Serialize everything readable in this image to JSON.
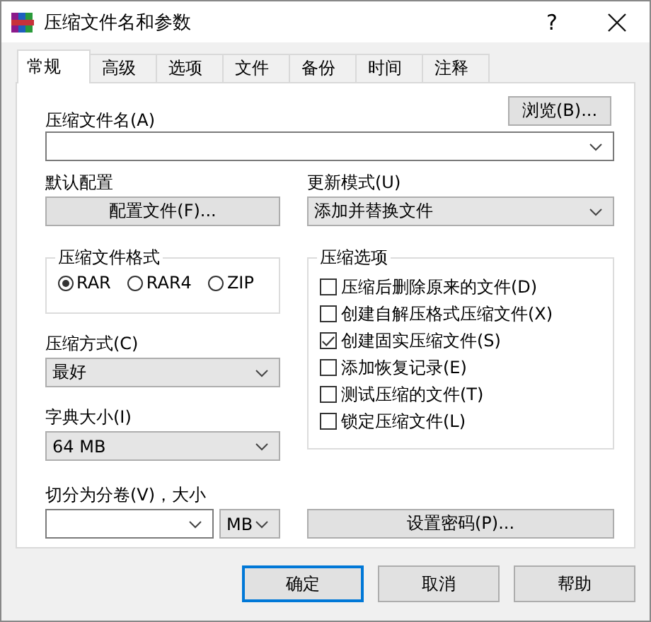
{
  "window": {
    "title": "压缩文件名和参数",
    "help_button": "?"
  },
  "tabs": [
    {
      "label": "常规",
      "selected": true
    },
    {
      "label": "高级",
      "selected": false
    },
    {
      "label": "选项",
      "selected": false
    },
    {
      "label": "文件",
      "selected": false
    },
    {
      "label": "备份",
      "selected": false
    },
    {
      "label": "时间",
      "selected": false
    },
    {
      "label": "注释",
      "selected": false
    }
  ],
  "archive_name": {
    "label": "压缩文件名(A)",
    "browse_button": "浏览(B)..."
  },
  "profile": {
    "label": "默认配置",
    "button": "配置文件(F)..."
  },
  "update_mode": {
    "label": "更新模式(U)",
    "value": "添加并替换文件"
  },
  "archive_format": {
    "label": "压缩文件格式",
    "options": [
      {
        "label": "RAR",
        "selected": true
      },
      {
        "label": "RAR4",
        "selected": false
      },
      {
        "label": "ZIP",
        "selected": false
      }
    ]
  },
  "compression_method": {
    "label": "压缩方式(C)",
    "value": "最好"
  },
  "dictionary_size": {
    "label": "字典大小(I)",
    "value": "64 MB"
  },
  "split_volumes": {
    "label": "切分为分卷(V)，大小",
    "unit": "MB"
  },
  "archiving_options": {
    "label": "压缩选项",
    "items": [
      {
        "label": "压缩后删除原来的文件(D)",
        "checked": false
      },
      {
        "label": "创建自解压格式压缩文件(X)",
        "checked": false
      },
      {
        "label": "创建固实压缩文件(S)",
        "checked": true
      },
      {
        "label": "添加恢复记录(E)",
        "checked": false
      },
      {
        "label": "测试压缩的文件(T)",
        "checked": false
      },
      {
        "label": "锁定压缩文件(L)",
        "checked": false
      }
    ]
  },
  "password_button": "设置密码(P)...",
  "buttons": [
    {
      "label": "确定",
      "default": true
    },
    {
      "label": "取消",
      "default": false
    },
    {
      "label": "帮助",
      "default": false
    }
  ]
}
